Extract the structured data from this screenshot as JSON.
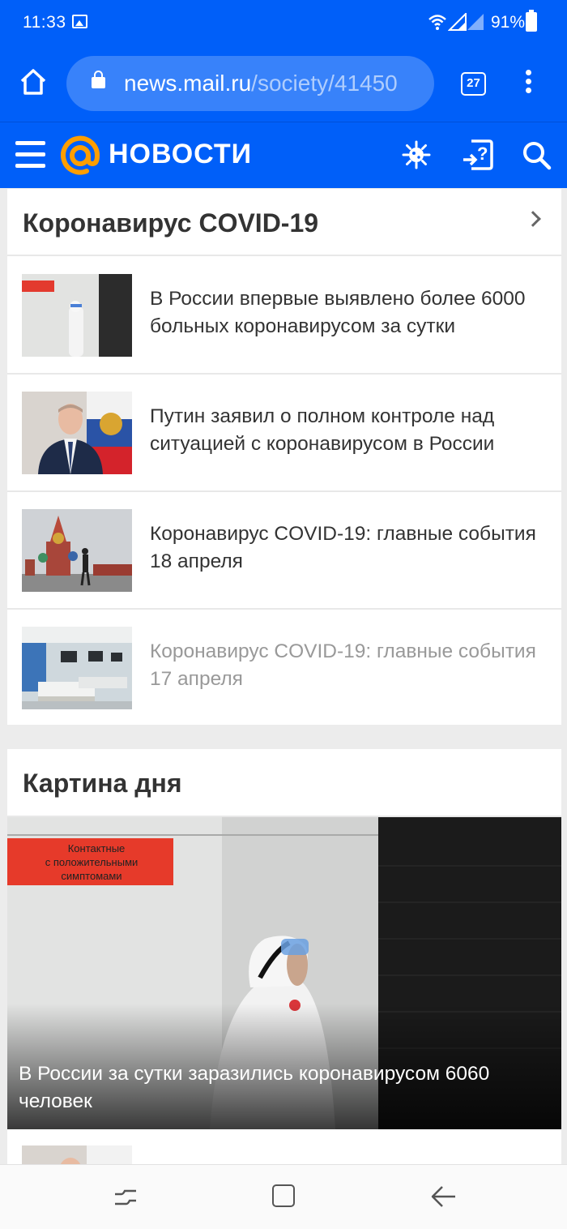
{
  "status_bar": {
    "time": "11:33",
    "battery": "91%"
  },
  "browser": {
    "url_domain": "news.mail.ru",
    "url_path": "/society/41450",
    "tab_count": "27"
  },
  "site": {
    "logo_text": "НОВОСТИ"
  },
  "covid_section": {
    "title": "Коронавирус COVID-19",
    "items": [
      {
        "title": "В России впервые выявлено более 6000 больных коронавирусом за сутки",
        "visited": false
      },
      {
        "title": "Путин заявил о полном контроле над ситуацией с коронавирусом в России",
        "visited": false
      },
      {
        "title": "Коронавирус COVID-19: главные события 18 апреля",
        "visited": false
      },
      {
        "title": "Коронавирус COVID-19: главные события 17 апреля",
        "visited": true
      }
    ]
  },
  "day_picture": {
    "title": "Картина дня",
    "hero_sign": [
      "Контактные",
      "с положительными",
      "симптомами"
    ],
    "hero_caption": "В России за сутки заразились коронавирусом 6060 человек"
  },
  "colors": {
    "brand_blue": "#005ff9",
    "logo_orange": "#ff9e00",
    "text_dark": "#333333",
    "text_visited": "#999999"
  }
}
